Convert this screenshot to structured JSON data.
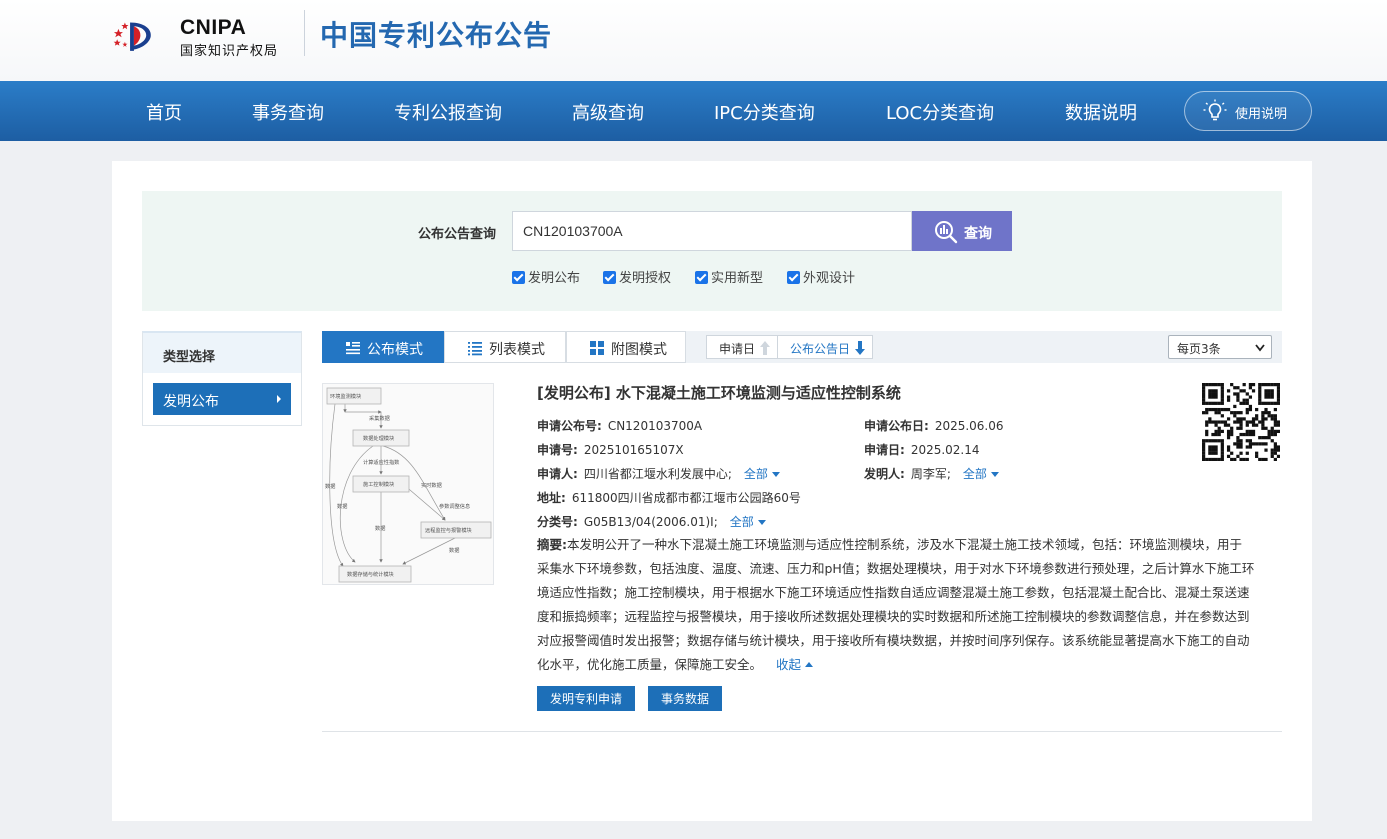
{
  "brand": {
    "logo_en": "CNIPA",
    "logo_cn": "国家知识产权局",
    "site_title": "中国专利公布公告"
  },
  "nav": {
    "items": [
      "首页",
      "事务查询",
      "专利公报查询",
      "高级查询",
      "IPC分类查询",
      "LOC分类查询",
      "数据说明"
    ],
    "help_label": "使用说明"
  },
  "search": {
    "label": "公布公告查询",
    "value": "CN120103700A",
    "button_label": "查询",
    "checkboxes": [
      {
        "label": "发明公布",
        "checked": true
      },
      {
        "label": "发明授权",
        "checked": true
      },
      {
        "label": "实用新型",
        "checked": true
      },
      {
        "label": "外观设计",
        "checked": true
      }
    ]
  },
  "sidebar": {
    "title": "类型选择",
    "items": [
      {
        "label": "发明公布",
        "active": true
      }
    ]
  },
  "toolbar": {
    "modes": [
      {
        "label": "公布模式",
        "active": true
      },
      {
        "label": "列表模式",
        "active": false
      },
      {
        "label": "附图模式",
        "active": false
      }
    ],
    "sorts": [
      {
        "label": "申请日",
        "active": false
      },
      {
        "label": "公布公告日",
        "active": true
      }
    ],
    "per_page": "每页3条"
  },
  "result": {
    "title": "[发明公布] 水下混凝土施工环境监测与适应性控制系统",
    "pub_no_label": "申请公布号:",
    "pub_no": "CN120103700A",
    "pub_date_label": "申请公布日:",
    "pub_date": "2025.06.06",
    "app_no_label": "申请号:",
    "app_no": "202510165107X",
    "app_date_label": "申请日:",
    "app_date": "2025.02.14",
    "applicant_label": "申请人:",
    "applicant": "四川省都江堰水利发展中心;",
    "inventor_label": "发明人:",
    "inventor": "周李军;",
    "address_label": "地址:",
    "address": "611800四川省成都市都江堰市公园路60号",
    "class_label": "分类号:",
    "class": "G05B13/04(2006.01)I;",
    "more_label": "全部",
    "abstract_label": "摘要:",
    "abstract_lines": [
      "本发明公开了一种水下混凝土施工环境监测与适应性控制系统，涉及水下混凝土施工技术领域，包括：环境监测模块，用于",
      "采集水下环境参数，包括浊度、温度、流速、压力和pH值；数据处理模块，用于对水下环境参数进行预处理，之后计算水下施工环",
      "境适应性指数；施工控制模块，用于根据水下施工环境适应性指数自适应调整混凝土施工参数，包括混凝土配合比、混凝土泵送速",
      "度和振捣频率；远程监控与报警模块，用于接收所述数据处理模块的实时数据和所述施工控制模块的参数调整信息，并在参数达到",
      "对应报警阈值时发出报警；数据存储与统计模块，用于接收所有模块数据，并按时间序列保存。该系统能显著提高水下施工的自动",
      "化水平，优化施工质量，保障施工安全。"
    ],
    "collapse_label": "收起",
    "btn_apply": "发明专利申请",
    "btn_affairs": "事务数据",
    "diagram": {
      "boxes": [
        "环境监测模块",
        "数据处理模块",
        "施工控制模块",
        "远程监控与报警模块",
        "数据存储与统计模块"
      ],
      "labels": [
        "采集数据",
        "计算适应性指数",
        "实时数据",
        "参数调整信息",
        "数据",
        "数据",
        "数据",
        "数据"
      ]
    }
  }
}
